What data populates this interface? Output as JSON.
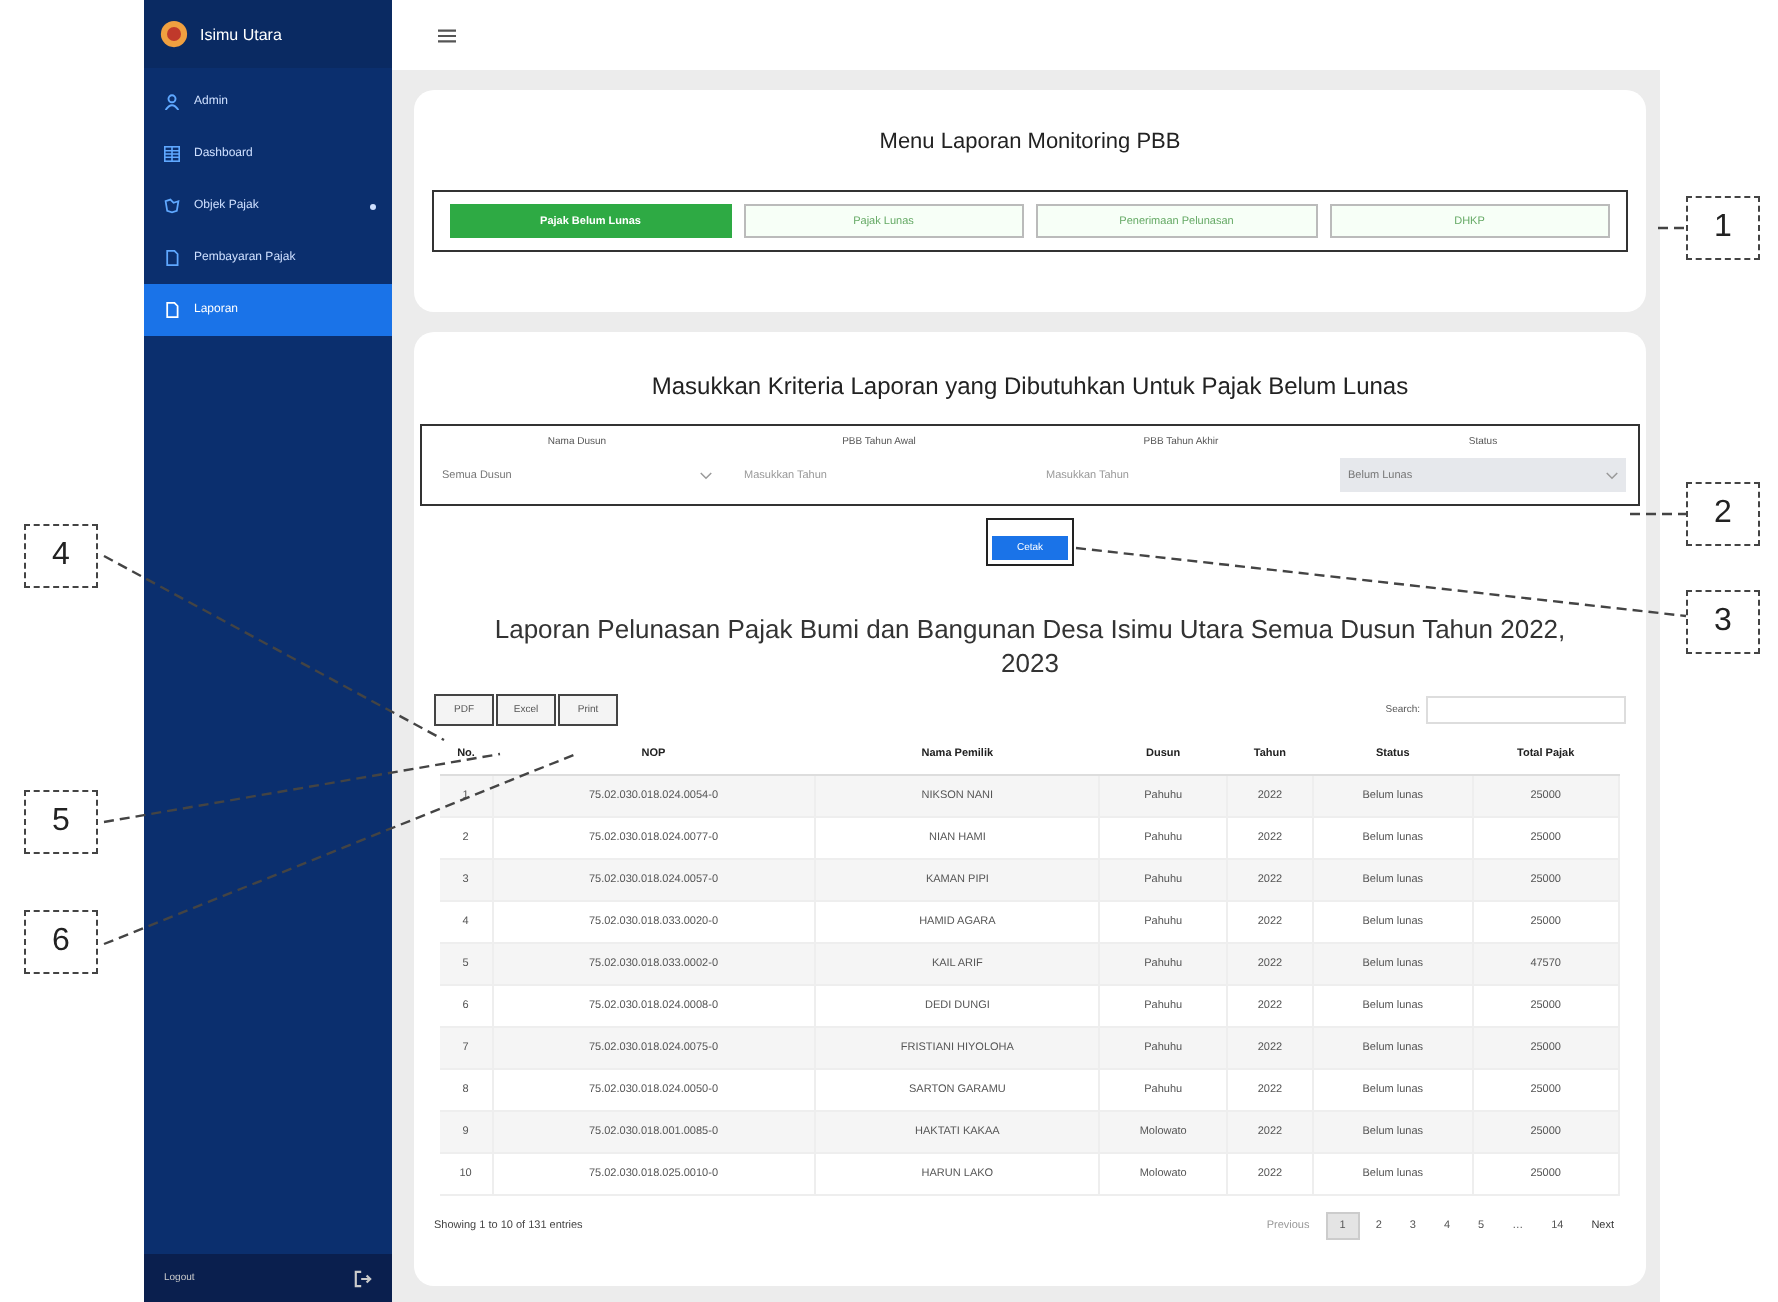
{
  "sidebar": {
    "brand": "Isimu Utara",
    "items": [
      {
        "label": "Admin",
        "selected": false,
        "expandable": false
      },
      {
        "label": "Dashboard",
        "selected": false,
        "expandable": false
      },
      {
        "label": "Objek Pajak",
        "selected": false,
        "expandable": true
      },
      {
        "label": "Pembayaran Pajak",
        "selected": false,
        "expandable": false
      },
      {
        "label": "Laporan",
        "selected": true,
        "expandable": false
      }
    ],
    "footer": "Logout"
  },
  "menu": {
    "title": "Menu Laporan Monitoring PBB",
    "tabs": [
      {
        "label": "Pajak Belum Lunas",
        "selected": true
      },
      {
        "label": "Pajak Lunas",
        "selected": false
      },
      {
        "label": "Penerimaan Pelunasan",
        "selected": false
      },
      {
        "label": "DHKP",
        "selected": false
      }
    ]
  },
  "criteria": {
    "title": "Masukkan Kriteria Laporan yang Dibutuhkan Untuk Pajak Belum Lunas",
    "fields": [
      {
        "label": "Nama Dusun",
        "kind": "select",
        "value": "Semua Dusun",
        "disabled": false
      },
      {
        "label": "PBB Tahun Awal",
        "kind": "input",
        "placeholder": "Masukkan Tahun",
        "disabled": false
      },
      {
        "label": "PBB Tahun Akhir",
        "kind": "input",
        "placeholder": "Masukkan Tahun",
        "disabled": false
      },
      {
        "label": "Status",
        "kind": "select",
        "value": "Belum Lunas",
        "disabled": true
      }
    ],
    "button": "Cetak"
  },
  "report": {
    "title": "Laporan Pelunasan Pajak Bumi dan Bangunan Desa Isimu Utara Semua Dusun Tahun 2022, 2023",
    "export_buttons": [
      "PDF",
      "Excel",
      "Print"
    ],
    "search_label": "Search:",
    "columns": [
      "No.",
      "NOP",
      "Nama Pemilik",
      "Dusun",
      "Tahun",
      "Status",
      "Total Pajak"
    ],
    "rows": [
      [
        "1",
        "75.02.030.018.024.0054-0",
        "NIKSON NANI",
        "Pahuhu",
        "2022",
        "Belum lunas",
        "25000"
      ],
      [
        "2",
        "75.02.030.018.024.0077-0",
        "NIAN HAMI",
        "Pahuhu",
        "2022",
        "Belum lunas",
        "25000"
      ],
      [
        "3",
        "75.02.030.018.024.0057-0",
        "KAMAN PIPI",
        "Pahuhu",
        "2022",
        "Belum lunas",
        "25000"
      ],
      [
        "4",
        "75.02.030.018.033.0020-0",
        "HAMID AGARA",
        "Pahuhu",
        "2022",
        "Belum lunas",
        "25000"
      ],
      [
        "5",
        "75.02.030.018.033.0002-0",
        "KAIL ARIF",
        "Pahuhu",
        "2022",
        "Belum lunas",
        "47570"
      ],
      [
        "6",
        "75.02.030.018.024.0008-0",
        "DEDI DUNGI",
        "Pahuhu",
        "2022",
        "Belum lunas",
        "25000"
      ],
      [
        "7",
        "75.02.030.018.024.0075-0",
        "FRISTIANI HIYOLOHA",
        "Pahuhu",
        "2022",
        "Belum lunas",
        "25000"
      ],
      [
        "8",
        "75.02.030.018.024.0050-0",
        "SARTON GARAMU",
        "Pahuhu",
        "2022",
        "Belum lunas",
        "25000"
      ],
      [
        "9",
        "75.02.030.018.001.0085-0",
        "HAKTATI KAKAA",
        "Molowato",
        "2022",
        "Belum lunas",
        "25000"
      ],
      [
        "10",
        "75.02.030.018.025.0010-0",
        "HARUN LAKO",
        "Molowato",
        "2022",
        "Belum lunas",
        "25000"
      ]
    ],
    "info": "Showing 1 to 10 of 131 entries",
    "pagination": {
      "previous": "Previous",
      "pages": [
        {
          "label": "1",
          "selected": true
        },
        {
          "label": "2",
          "selected": false
        },
        {
          "label": "3",
          "selected": false
        },
        {
          "label": "4",
          "selected": false
        },
        {
          "label": "5",
          "selected": false
        },
        {
          "label": "…",
          "selected": false
        },
        {
          "label": "14",
          "selected": false
        }
      ],
      "next": "Next"
    }
  },
  "annotations": [
    "1",
    "2",
    "3",
    "4",
    "5",
    "6"
  ]
}
